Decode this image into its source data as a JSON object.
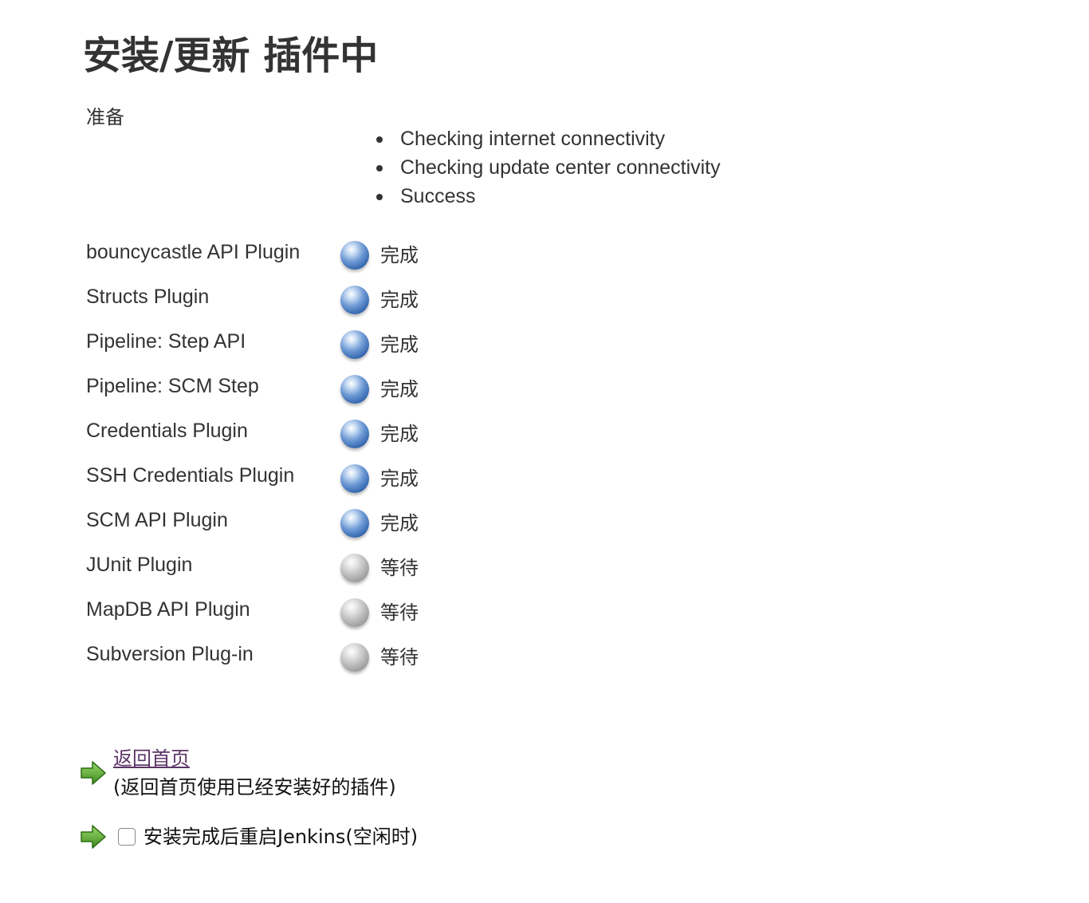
{
  "page": {
    "title": "安装/更新 插件中"
  },
  "preparation": {
    "label": "准备",
    "steps": [
      "Checking internet connectivity",
      "Checking update center connectivity",
      "Success"
    ]
  },
  "plugins": [
    {
      "name": "bouncycastle API Plugin",
      "status": "完成",
      "state": "done"
    },
    {
      "name": "Structs Plugin",
      "status": "完成",
      "state": "done"
    },
    {
      "name": "Pipeline: Step API",
      "status": "完成",
      "state": "done"
    },
    {
      "name": "Pipeline: SCM Step",
      "status": "完成",
      "state": "done"
    },
    {
      "name": "Credentials Plugin",
      "status": "完成",
      "state": "done"
    },
    {
      "name": "SSH Credentials Plugin",
      "status": "完成",
      "state": "done"
    },
    {
      "name": "SCM API Plugin",
      "status": "完成",
      "state": "done"
    },
    {
      "name": "JUnit Plugin",
      "status": "等待",
      "state": "pending"
    },
    {
      "name": "MapDB API Plugin",
      "status": "等待",
      "state": "pending"
    },
    {
      "name": "Subversion Plug-in",
      "status": "等待",
      "state": "pending"
    }
  ],
  "footer": {
    "home_link_label": "返回首页",
    "home_link_desc": "(返回首页使用已经安装好的插件)",
    "restart_label": "安装完成后重启Jenkins(空闲时)",
    "restart_checked": false
  },
  "colors": {
    "link": "#5c3566",
    "done_ball": "#4a7cc4",
    "pending_ball": "#b0b0b0",
    "arrow": "#5fa832"
  },
  "icons": {
    "done": "blue-ball-icon",
    "pending": "grey-ball-icon",
    "action": "green-arrow-icon"
  }
}
